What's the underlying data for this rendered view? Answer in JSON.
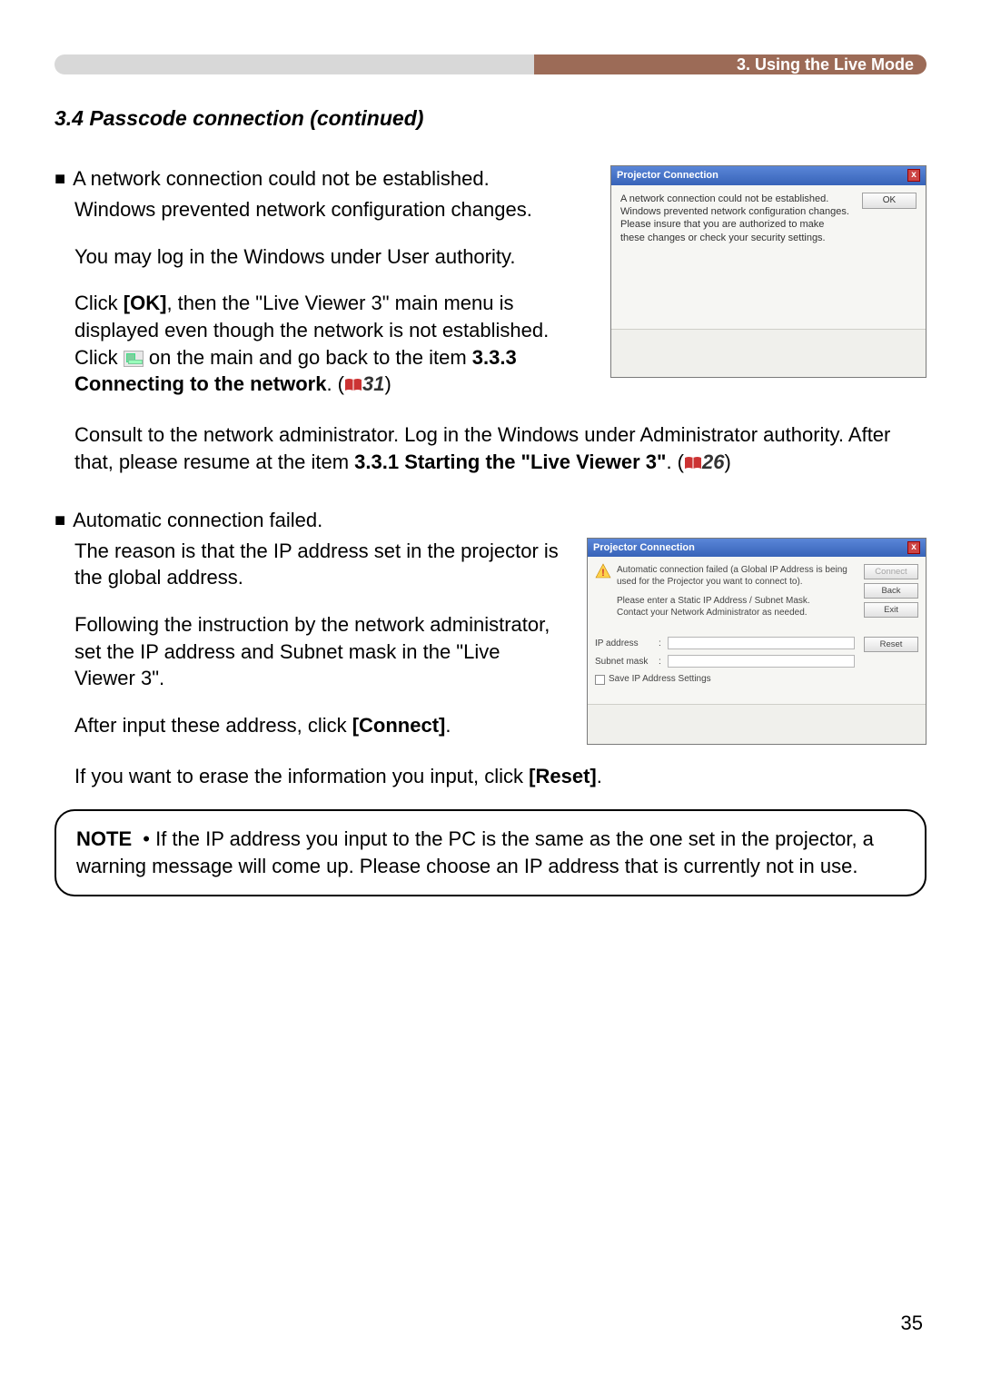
{
  "header": {
    "breadcrumb": "3. Using the Live Mode"
  },
  "section": {
    "title": "3.4 Passcode connection (continued)"
  },
  "issue1": {
    "bullet_text": "A network connection could not be established.",
    "line1": "Windows prevented network configuration changes.",
    "line2": "You may log in the Windows under User authority.",
    "p3a": "Click ",
    "p3b_bold": "[OK]",
    "p3c": ", then the \"Live Viewer 3\" main menu is displayed even though the network is not established. Click ",
    "p3d": " on the main and go back to the item ",
    "p3e_bold": "3.3.3 Connecting to the network",
    "p3f": ". (",
    "p3g_ref": "31",
    "p3h": ")",
    "p4a": "Consult to the network administrator. Log in the Windows under Administrator authority. After that, please resume at the item ",
    "p4b_bold": "3.3.1 Starting the \"Live Viewer 3\"",
    "p4c": ". (",
    "p4d_ref": "26",
    "p4e": ")"
  },
  "dialog1": {
    "title": "Projector Connection",
    "close_label": "x",
    "text": "A network connection could not be established.\nWindows prevented network configuration changes.\nPlease insure that you are authorized to make these changes or check your security settings.",
    "ok": "OK"
  },
  "issue2": {
    "bullet_text": "Automatic connection failed.",
    "line1": "The reason is that the IP address set in the projector is the global address.",
    "line2": "Following the instruction by the network administrator, set the IP address and Subnet mask in the \"Live Viewer 3\".",
    "p3a": "After input these address, click ",
    "p3b_bold": "[Connect]",
    "p3c": ".",
    "p4a": "If you want to erase the information you input, click ",
    "p4b_bold": "[Reset]",
    "p4c": "."
  },
  "dialog2": {
    "title": "Projector Connection",
    "close_label": "x",
    "msg1": "Automatic connection failed (a Global IP Address is being used for the Projector you want to connect to).",
    "msg2": "Please enter a Static IP Address / Subnet Mask.\nContact your Network Administrator as needed.",
    "ip_label": "IP address",
    "subnet_label": "Subnet mask",
    "save_label": "Save IP Address Settings",
    "connect": "Connect",
    "back": "Back",
    "exit": "Exit",
    "reset": "Reset"
  },
  "note": {
    "label": "NOTE",
    "bullet": "• ",
    "text": "If the IP address you input to the PC is the same as the one set in the projector, a warning message will come up.  Please choose an IP address that is currently not in use."
  },
  "page_number": "35"
}
